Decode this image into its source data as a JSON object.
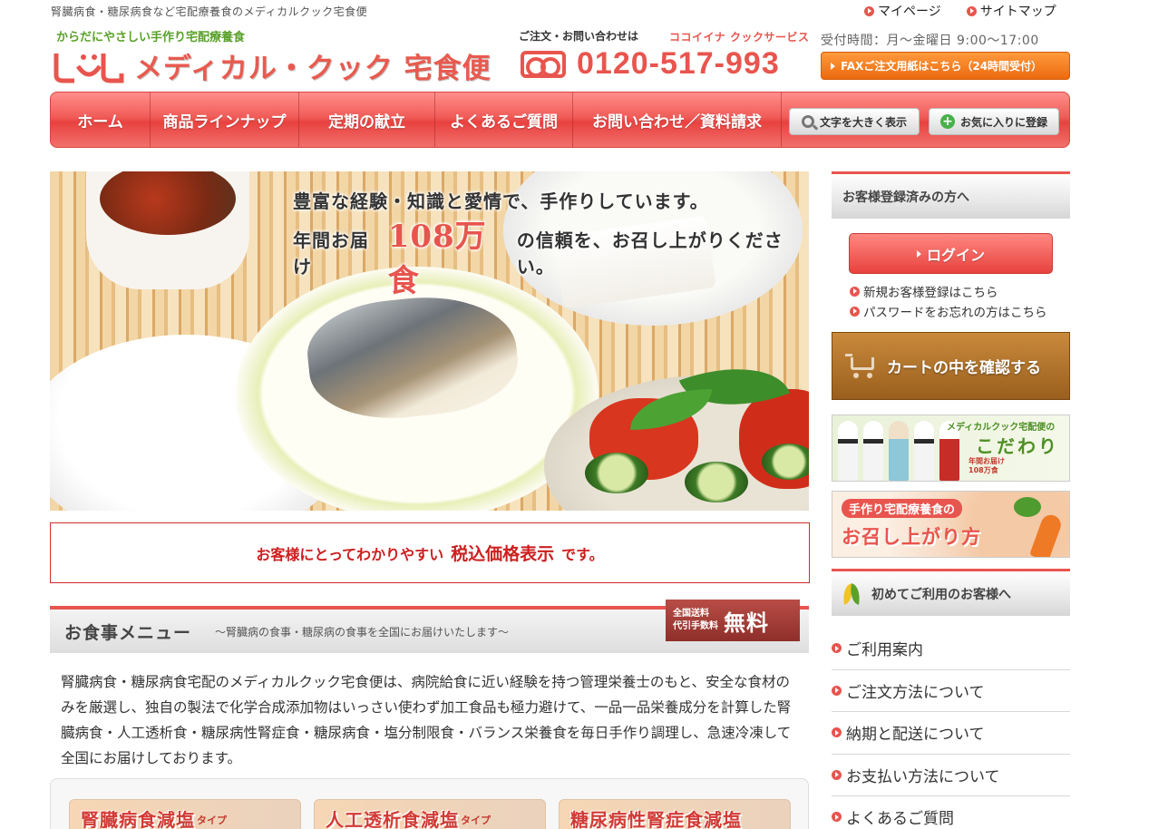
{
  "header": {
    "tagline_top": "腎臓病食・糖尿病食など宅配療養食のメディカルクック宅食便",
    "links": [
      "マイページ",
      "サイトマップ"
    ],
    "logo_tagline": "からだにやさしい手作り宅配療養食",
    "logo_name": "メディカル・クック 宅食便",
    "contact_label": "ご注文・お問い合わせは",
    "company": "ココイイナ クックサービス",
    "phone": "0120-517-993",
    "hours": "受付時間：月～金曜日 9:00～17:00",
    "fax_button": "FAXご注文用紙はこちら（24時間受付）"
  },
  "nav": {
    "items": [
      "ホーム",
      "商品ラインナップ",
      "定期の献立",
      "よくあるご質問",
      "お問い合わせ／資料請求"
    ],
    "text_size_button": "文字を大きく表示",
    "favorite_button": "お気に入りに登録"
  },
  "hero": {
    "line1": "豊富な経験・知識と愛情で、手作りしています。",
    "line2_pre": "年間お届け",
    "line2_big": "108万食",
    "line2_post": "の信頼を、お召し上がりください。"
  },
  "notice": {
    "pre": "お客様にとってわかりやすい",
    "emphasis": "税込価格表示",
    "post": "です。"
  },
  "menu": {
    "title": "お食事メニュー",
    "subtitle": "～腎臓病の食事・糖尿病の食事を全国にお届けいたします～",
    "badge_line1": "全国送料",
    "badge_line2": "代引手数料",
    "badge_free": "無料",
    "description": "腎臓病食・糖尿病食宅配のメディカルクック宅食便は、病院給食に近い経験を持つ管理栄養士のもと、安全な食材のみを厳選し、独自の製法で化学合成添加物はいっさい使わず加工食品も極力避けて、一品一品栄養成分を計算した腎臓病食・人工透析食・糖尿病性腎症食・糖尿病食・塩分制限食・バランス栄養食を毎日手作り調理し、急速冷凍して全国にお届けしております。",
    "tiles": [
      {
        "label": "腎臓病食減塩",
        "suffix": "タイプ"
      },
      {
        "label": "人工透析食減塩",
        "suffix": "タイプ"
      },
      {
        "label": "糖尿病性腎症食減塩",
        "suffix": ""
      }
    ]
  },
  "sidebar": {
    "registered_heading": "お客様登録済みの方へ",
    "login_button": "ログイン",
    "register_link": "新規お客様登録はこちら",
    "password_link": "パスワードをお忘れの方はこちら",
    "cart_button": "カートの中を確認する",
    "kodawari_small": "メディカルクック宅配便の",
    "kodawari_big": "こだわり",
    "kodawari_badge1": "年間お届け",
    "kodawari_badge2": "108万食",
    "meshi_line1": "手作り宅配療養食の",
    "meshi_line2": "お召し上がり方",
    "first_time_heading": "初めてご利用のお客様へ",
    "guide_items": [
      "ご利用案内",
      "ご注文方法について",
      "納期と配送について",
      "お支払い方法について",
      "よくあるご質問"
    ]
  },
  "colors": {
    "accent": "#e8554e",
    "nav_red": "#f05c58",
    "fax_orange": "#ec6a10",
    "notice_red": "#cc1f1f",
    "cart_brown": "#9a5f1e",
    "green": "#5aa12a"
  }
}
